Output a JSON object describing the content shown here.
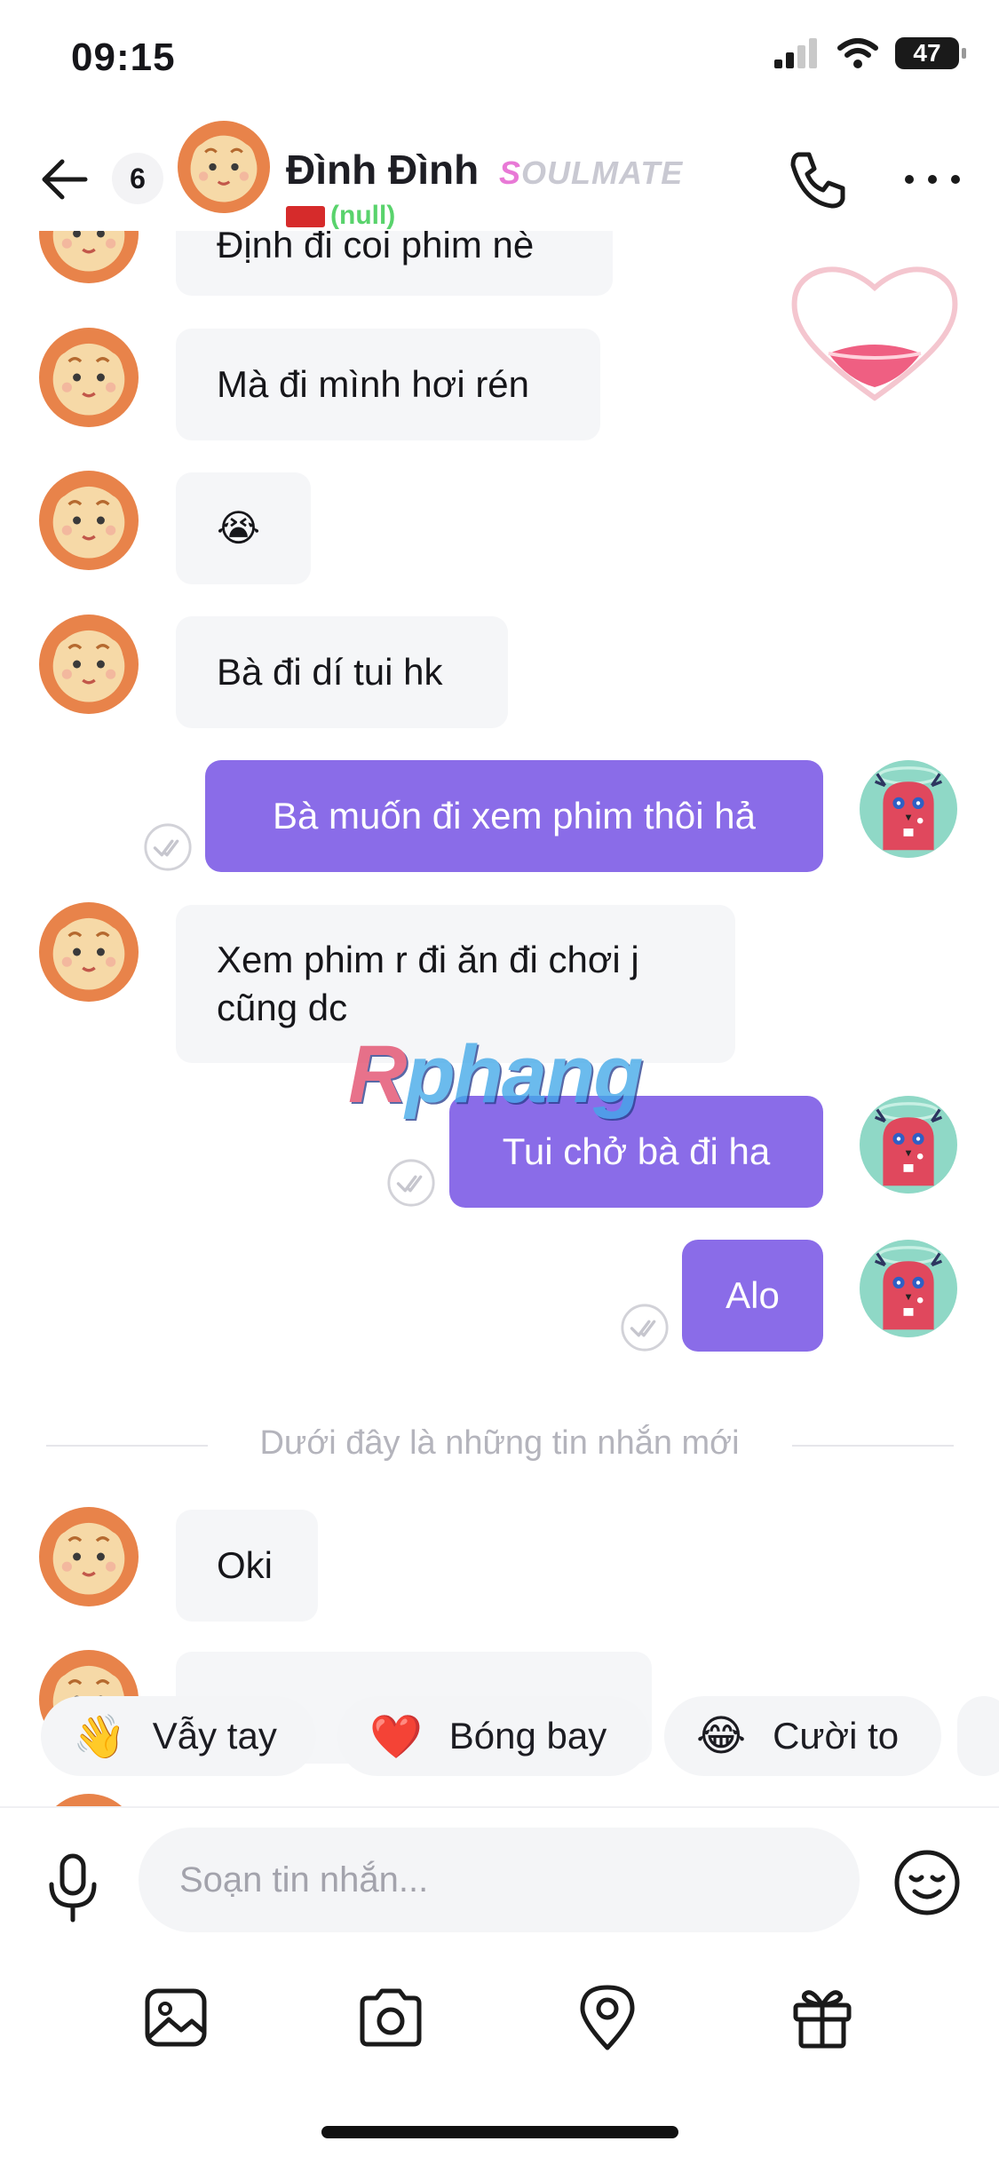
{
  "status_bar": {
    "time": "09:15",
    "battery": "47"
  },
  "header": {
    "unread_count": "6",
    "contact_name": "Đình Đình",
    "badge": {
      "first": "S",
      "rest": "OULMATE"
    },
    "sub_status": "(null)"
  },
  "messages": [
    {
      "from": "them",
      "text": "Định đi coi phim nè"
    },
    {
      "from": "them",
      "text": "Mà đi mình hơi rén"
    },
    {
      "from": "them",
      "text": "😭"
    },
    {
      "from": "them",
      "text": "Bà đi dí tui hk"
    },
    {
      "from": "me",
      "text": "Bà muốn đi xem phim thôi hả"
    },
    {
      "from": "them",
      "text_line1": "Xem phim r đi ăn đi chơi j",
      "text_line2": "cũng dc"
    },
    {
      "from": "me",
      "text": "Tui chở bà đi ha"
    },
    {
      "from": "me",
      "text": "Alo"
    },
    {
      "from": "them",
      "text": "Oki"
    }
  ],
  "divider": "Dưới đây là những tin nhắn mới",
  "watermark": {
    "first": "R",
    "rest": "phang"
  },
  "quick_reactions": [
    {
      "emoji": "👋",
      "label": "Vẫy tay"
    },
    {
      "emoji": "❤️",
      "label": "Bóng bay"
    },
    {
      "emoji": "😂",
      "label": "Cười to"
    }
  ],
  "composer": {
    "placeholder": "Soạn tin nhắn..."
  },
  "icons": [
    "back-arrow-icon",
    "phone-icon",
    "more-icon",
    "microphone-icon",
    "emoji-icon",
    "image-icon",
    "camera-icon",
    "location-icon",
    "gift-icon",
    "read-check-icon",
    "heart-sticker-icon"
  ],
  "colors": {
    "outgoing_bubble": "#8a6ce8",
    "incoming_bubble": "#f5f6f8",
    "online_green": "#59d36c",
    "badge_pink": "#e879d6"
  }
}
